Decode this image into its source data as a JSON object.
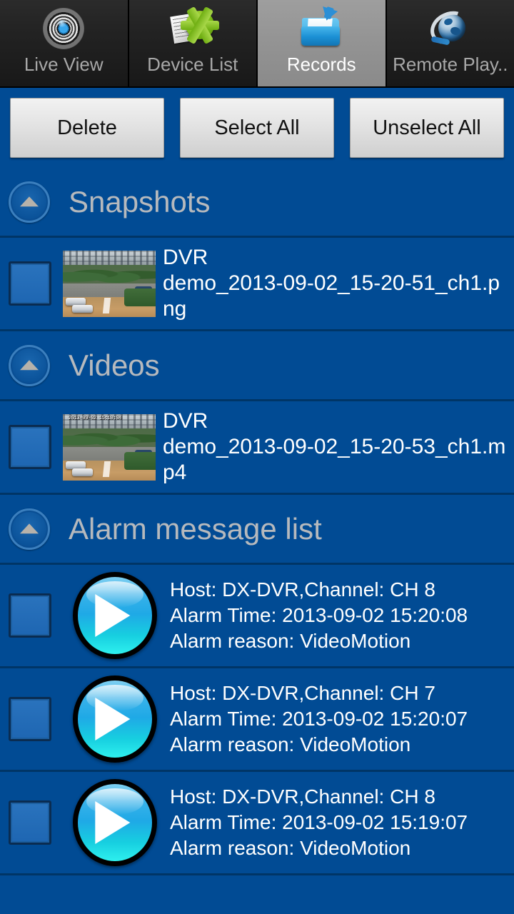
{
  "tabs": [
    {
      "label": "Live View",
      "icon": "lens-icon",
      "active": false
    },
    {
      "label": "Device List",
      "icon": "devicelist-icon",
      "active": false
    },
    {
      "label": "Records",
      "icon": "folder-icon",
      "active": true
    },
    {
      "label": "Remote Play..",
      "icon": "globe-icon",
      "active": false
    }
  ],
  "toolbar": {
    "delete_label": "Delete",
    "select_all_label": "Select All",
    "unselect_all_label": "Unselect All"
  },
  "sections": [
    {
      "title": "Snapshots",
      "collapse_icon": "triangle-up-icon",
      "rows": [
        {
          "checked": false,
          "thumb_timestamp": "",
          "line1": "DVR",
          "line2": "demo_2013-09-02_15-20-51_ch1.png"
        }
      ]
    },
    {
      "title": "Videos",
      "collapse_icon": "triangle-up-icon",
      "rows": [
        {
          "checked": false,
          "thumb_timestamp": "2013-09-02 15:10:04",
          "line1": "DVR",
          "line2": "demo_2013-09-02_15-20-53_ch1.mp4"
        }
      ]
    },
    {
      "title": "Alarm message list",
      "collapse_icon": "triangle-up-icon",
      "alarms": [
        {
          "checked": false,
          "host_line": "Host: DX-DVR,Channel: CH 8",
          "time_line": "Alarm Time: 2013-09-02 15:20:08",
          "reason_line": "Alarm reason: VideoMotion"
        },
        {
          "checked": false,
          "host_line": "Host: DX-DVR,Channel: CH 7",
          "time_line": "Alarm Time: 2013-09-02 15:20:07",
          "reason_line": "Alarm reason: VideoMotion"
        },
        {
          "checked": false,
          "host_line": "Host: DX-DVR,Channel: CH 8",
          "time_line": "Alarm Time: 2013-09-02 15:19:07",
          "reason_line": "Alarm reason: VideoMotion"
        }
      ]
    }
  ],
  "colors": {
    "background_blue": "#014b94",
    "divider_navy": "#003566",
    "tab_bar_dark": "#1b1b1b",
    "tab_active_gray": "#949494",
    "section_title_gray": "#b6b9bd",
    "row_text_white": "#ffffff",
    "play_button_cyan": "#1fa9e6"
  }
}
